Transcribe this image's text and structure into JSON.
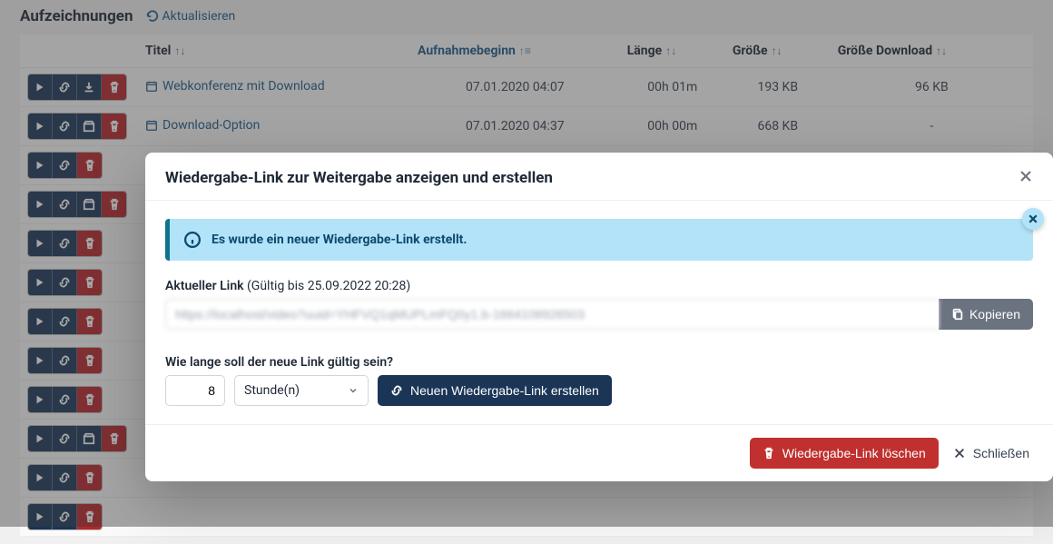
{
  "header": {
    "title": "Aufzeichnungen",
    "refresh_label": "Aktualisieren"
  },
  "columns": {
    "title": "Titel",
    "start": "Aufnahmebeginn",
    "length": "Länge",
    "size": "Größe",
    "download_size": "Größe Download"
  },
  "rows": [
    {
      "title": "Webkonferenz mit Download",
      "start": "07.01.2020 04:07",
      "length": "00h 01m",
      "size": "193 KB",
      "download_size": "96 KB",
      "has_download": true,
      "has_box": false
    },
    {
      "title": "Download-Option",
      "start": "07.01.2020 04:37",
      "length": "00h 00m",
      "size": "668 KB",
      "download_size": "-",
      "has_download": false,
      "has_box": true
    }
  ],
  "stub_count": 10,
  "dialog": {
    "title": "Wiedergabe-Link zur Weitergabe anzeigen und erstellen",
    "toast": "Es wurde ein neuer Wiedergabe-Link erstellt.",
    "current_label_strong": "Aktueller Link",
    "current_label_note": "(Gültig bis 25.09.2022 20:28)",
    "link_value": "https://localhost/video?uuid=YHFVQ1qMUPLmFQ0y1.b-1664108926503",
    "copy_label": "Kopieren",
    "duration_question": "Wie lange soll der neue Link gültig sein?",
    "duration_value": "8",
    "unit_label": "Stunde(n)",
    "create_label": "Neuen Wiedergabe-Link erstellen",
    "delete_label": "Wiedergabe-Link löschen",
    "close_label": "Schließen"
  }
}
